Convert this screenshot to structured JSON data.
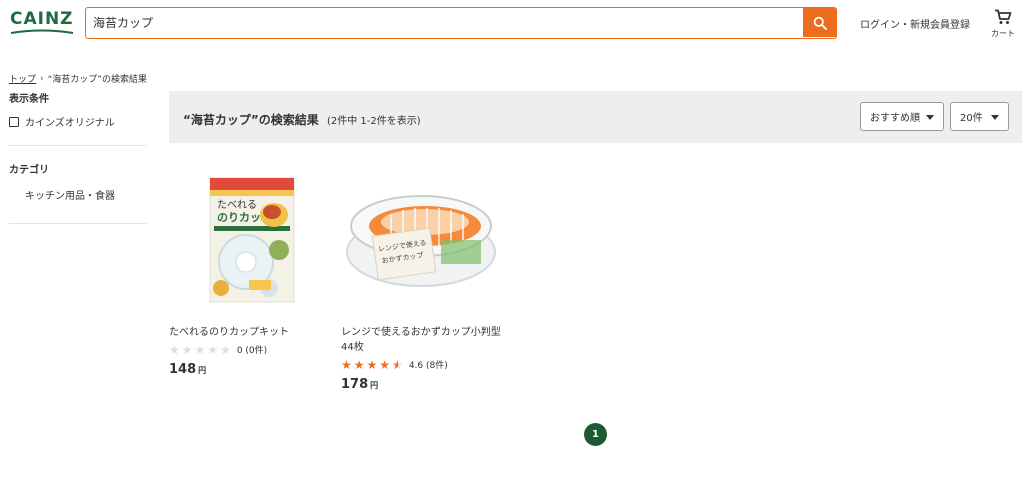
{
  "header": {
    "logo_text": "CAINZ",
    "search_value": "海苔カップ",
    "login_label": "ログイン・新規会員登録",
    "cart_label": "カート"
  },
  "breadcrumb": {
    "home": "トップ",
    "current": "“海苔カップ”の検索結果"
  },
  "sidebar": {
    "display_heading": "表示条件",
    "cainz_original_label": "カインズオリジナル",
    "category_heading": "カテゴリ",
    "category_items": [
      "キッチン用品・食器"
    ]
  },
  "results": {
    "title": "“海苔カップ”の検索結果",
    "count_text": "(2件中 1-2件を表示)",
    "sort_label": "おすすめ順",
    "per_page_label": "20件"
  },
  "products": [
    {
      "name": "たべれるのりカップキット",
      "rating_value": 0,
      "rating_text": "0 (0件)",
      "price": "148",
      "yen": "円",
      "package_text_1": "たべれる",
      "package_text_2": "のりカップ"
    },
    {
      "name": "レンジで使えるおかずカップ小判型44枚",
      "rating_value": 4.6,
      "rating_text": "4.6 (8件)",
      "price": "178",
      "yen": "円",
      "package_text_1": "レンジで使える",
      "package_text_2": "おかずカップ"
    }
  ],
  "pagination": {
    "current_page": "1"
  },
  "colors": {
    "brand_green": "#1d6b3f",
    "accent_orange": "#ed6c1e"
  }
}
